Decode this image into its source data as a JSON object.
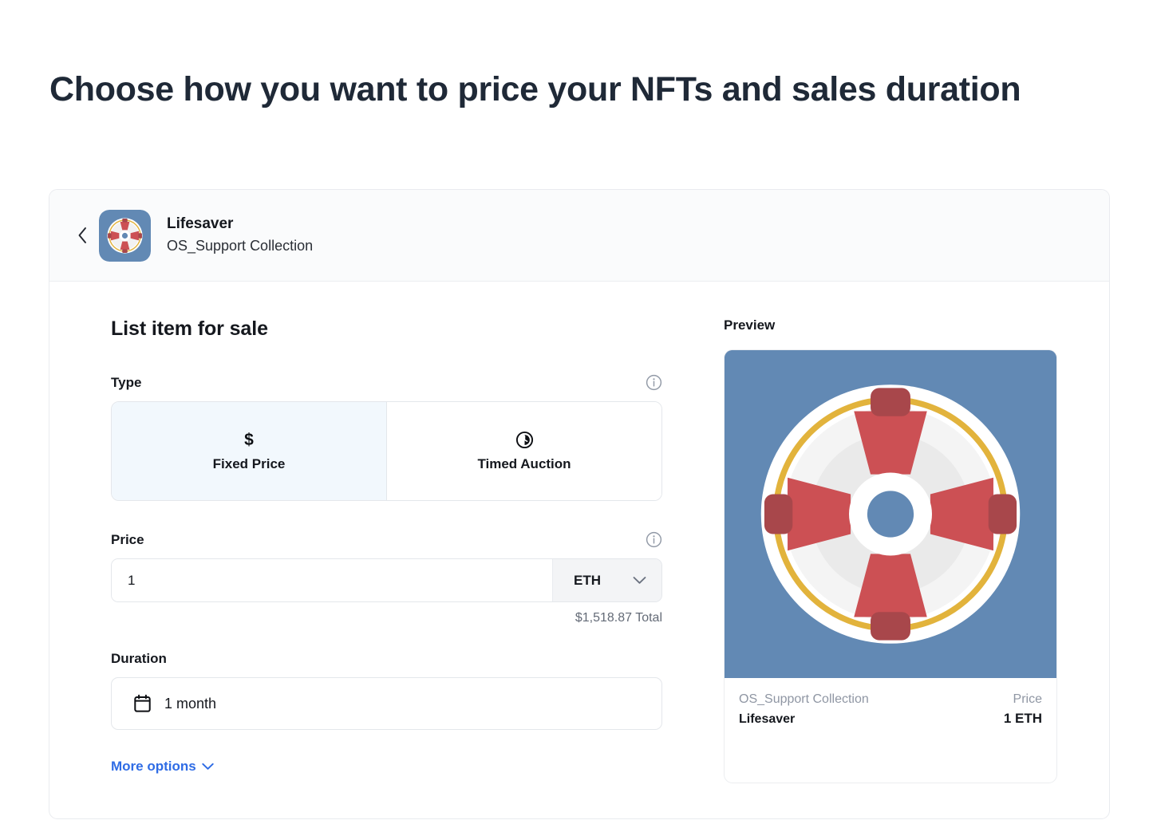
{
  "page": {
    "title": "Choose how you want to price your NFTs and sales duration"
  },
  "header": {
    "back_icon": "chevron-left-icon",
    "item_name": "Lifesaver",
    "collection_name": "OS_Support Collection"
  },
  "form": {
    "section_title": "List item for sale",
    "type": {
      "label": "Type",
      "info_icon": "info-icon",
      "options": [
        {
          "label": "Fixed Price",
          "icon": "dollar-icon",
          "icon_glyph": "$",
          "selected": true
        },
        {
          "label": "Timed Auction",
          "icon": "clock-icon",
          "icon_glyph": "",
          "selected": false
        }
      ]
    },
    "price": {
      "label": "Price",
      "info_icon": "info-icon",
      "value": "1",
      "placeholder": "Amount",
      "currency": "ETH",
      "currency_chevron": "chevron-down-icon",
      "total": "$1,518.87 Total"
    },
    "duration": {
      "label": "Duration",
      "icon": "calendar-icon",
      "value": "1 month"
    },
    "more_options": {
      "label": "More options",
      "chevron": "chevron-down-icon"
    }
  },
  "preview": {
    "title": "Preview",
    "art_alt": "lifesaver-artwork",
    "collection_name": "OS_Support Collection",
    "item_name": "Lifesaver",
    "price_label": "Price",
    "price_value": "1 ETH"
  },
  "colors": {
    "accent_link": "#2f6ce5",
    "selected_tab_bg": "#f2f8fd",
    "art_background": "#6289b4",
    "art_red": "#cc5054",
    "art_red_dark": "#a8474b",
    "art_gold": "#e2b33c",
    "art_white": "#ffffff",
    "panel_border": "#e9ebef",
    "header_bg": "#fafbfc"
  }
}
